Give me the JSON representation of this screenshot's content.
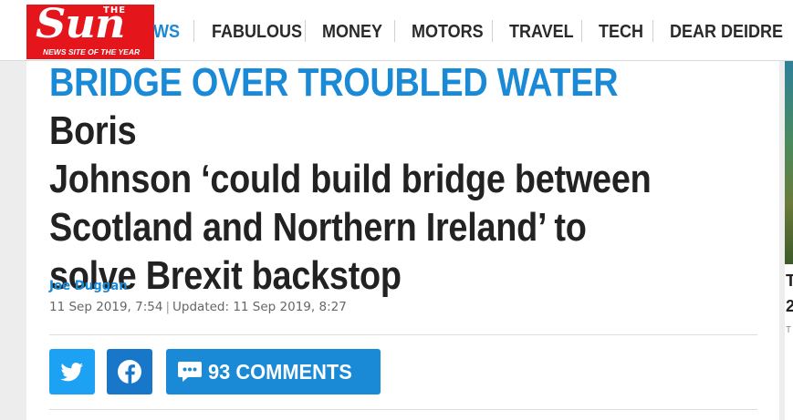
{
  "brand": {
    "top_word": "THE",
    "wordmark": "Sun",
    "strapline": "NEWS SITE OF THE YEAR",
    "color": "#e4161c"
  },
  "nav": {
    "items": [
      {
        "label": "WS"
      },
      {
        "label": "FABULOUS"
      },
      {
        "label": "MONEY"
      },
      {
        "label": "MOTORS"
      },
      {
        "label": "TRAVEL"
      },
      {
        "label": "TECH"
      },
      {
        "label": "DEAR DEIDRE"
      }
    ]
  },
  "article": {
    "kicker": "BRIDGE OVER TROUBLED WATER",
    "headline_lines": [
      " Boris",
      "Johnson ‘could build bridge between",
      "Scotland and Northern Ireland’ to",
      "solve Brexit backstop"
    ],
    "author": "Joe Duggan",
    "published": "11 Sep 2019, 7:54",
    "updated_label": "Updated: 11 Sep 2019, 8:27",
    "accent_color": "#1a8ad6"
  },
  "share": {
    "twitter_icon": "twitter-bird-icon",
    "facebook_icon": "facebook-f-icon",
    "comments_icon": "speech-bubble-icon",
    "comments_label": "93 COMMENTS"
  },
  "sidebar": {
    "teaser_line1": "T",
    "teaser_line2": "2",
    "teaser_meta": "T"
  }
}
